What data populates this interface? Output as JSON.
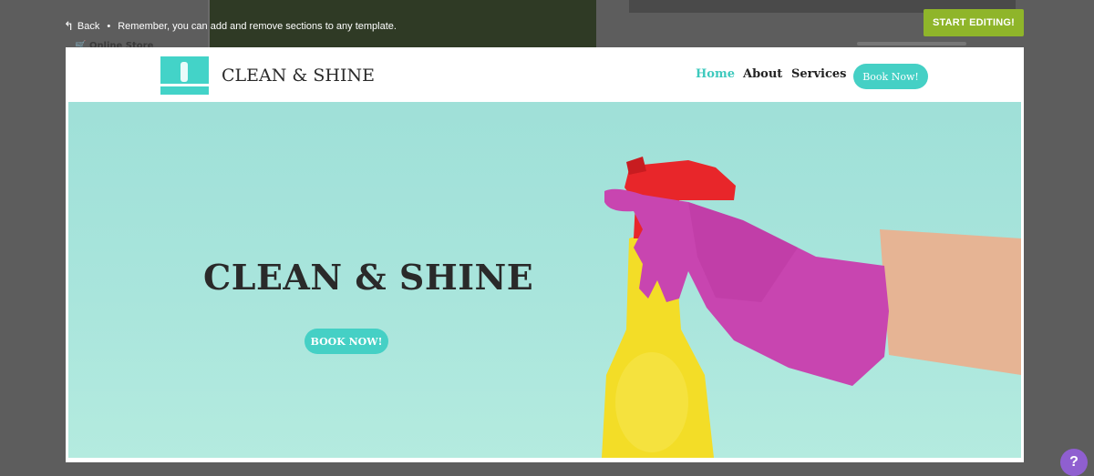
{
  "overlay": {
    "back_label": "Back",
    "separator": "•",
    "notice": "Remember, you can add and remove sections to any template.",
    "start_editing_label": "START EDITING!",
    "help_label": "?"
  },
  "background": {
    "online_store_label": "Online Store"
  },
  "site": {
    "title": "CLEAN & SHINE",
    "nav": [
      "Home",
      "About",
      "Services"
    ],
    "book_label": "Book Now!"
  },
  "hero": {
    "title": "CLEAN & SHINE",
    "button_label": "BOOK NOW!"
  },
  "colors": {
    "accent": "#45d0c5",
    "start_editing": "#8fb52a",
    "help": "#8f5fd0",
    "glove": "#c845b0",
    "bottle": "#f3dd27",
    "trigger": "#e8262a"
  }
}
